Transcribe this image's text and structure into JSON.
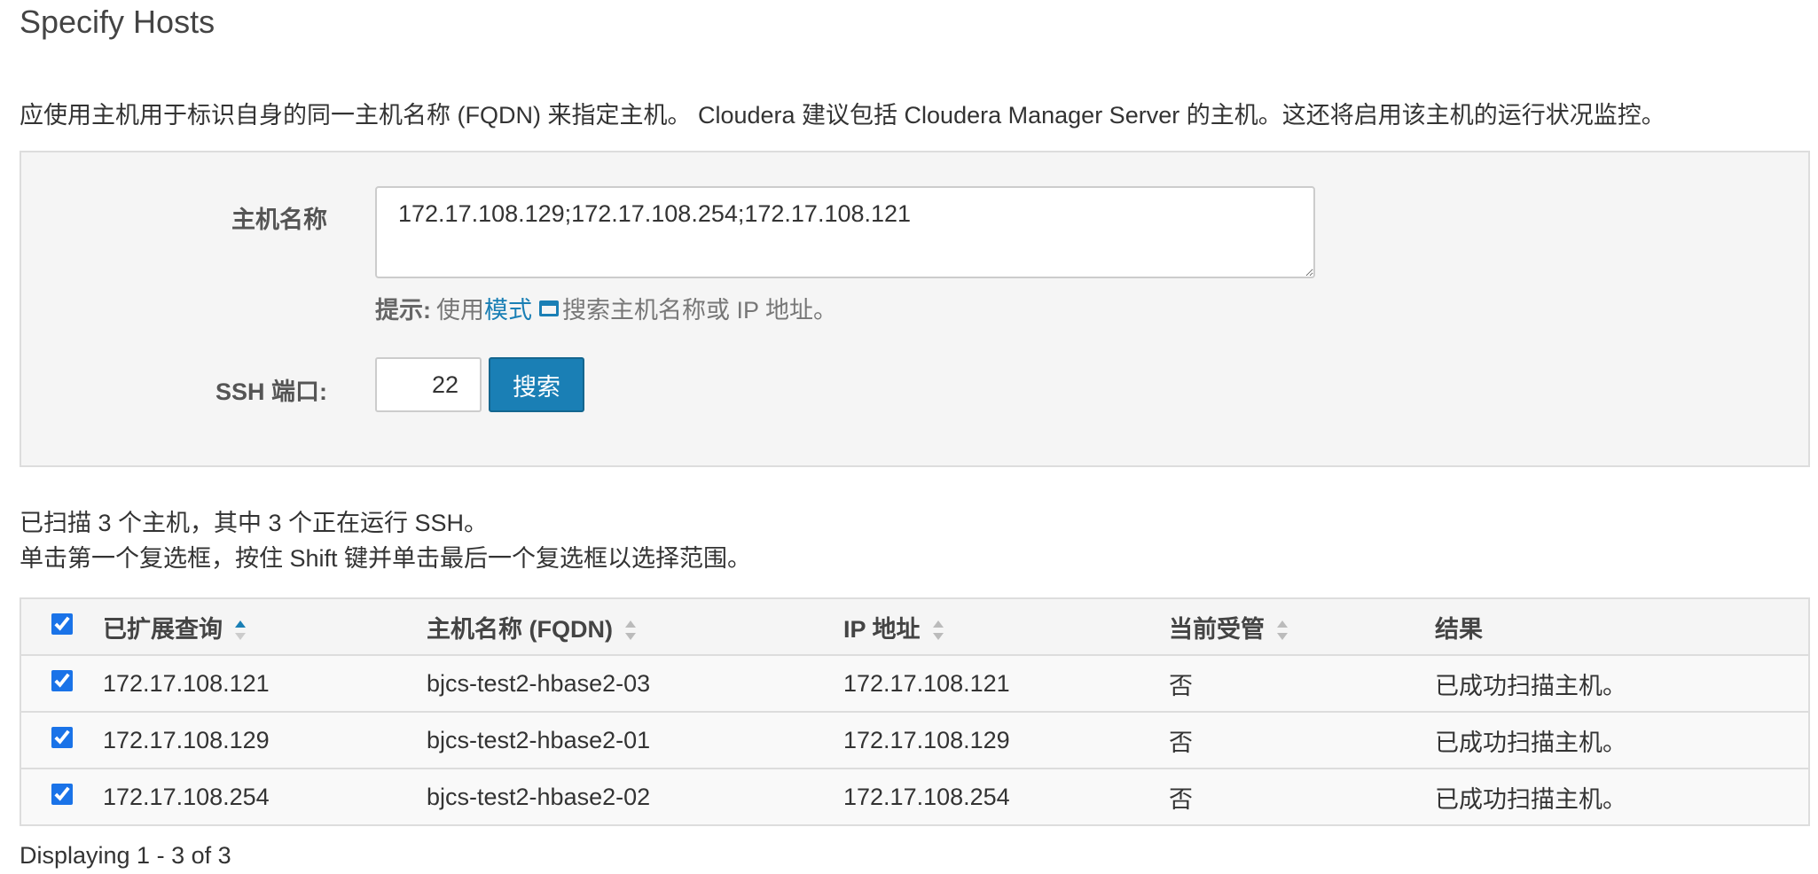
{
  "page": {
    "title": "Specify Hosts",
    "intro": "应使用主机用于标识自身的同一主机名称 (FQDN) 来指定主机。 Cloudera 建议包括 Cloudera Manager Server 的主机。这还将启用该主机的运行状况监控。"
  },
  "form": {
    "hostnames_label": "主机名称",
    "hostnames_value": "172.17.108.129;172.17.108.254;172.17.108.121",
    "hint_prefix": "提示:",
    "hint_text_before": "使用",
    "hint_link": "模式",
    "hint_icon": "window-icon",
    "hint_text_after": "搜索主机名称或 IP 地址。",
    "ssh_label": "SSH 端口:",
    "ssh_port": "22",
    "search_button": "搜索"
  },
  "scan": {
    "summary_line1": "已扫描 3 个主机，其中 3 个正在运行 SSH。",
    "summary_line2": "单击第一个复选框，按住 Shift 键并单击最后一个复选框以选择范围。"
  },
  "table": {
    "select_all_checked": true,
    "columns": [
      {
        "label": "已扩展查询",
        "sortable": true,
        "active": true
      },
      {
        "label": "主机名称 (FQDN)",
        "sortable": true,
        "active": false
      },
      {
        "label": "IP 地址",
        "sortable": true,
        "active": false
      },
      {
        "label": "当前受管",
        "sortable": true,
        "active": false
      },
      {
        "label": "结果",
        "sortable": false,
        "active": false
      }
    ],
    "rows": [
      {
        "checked": true,
        "expanded_query": "172.17.108.121",
        "fqdn": "bjcs-test2-hbase2-03",
        "ip": "172.17.108.121",
        "managed": "否",
        "result": "已成功扫描主机。"
      },
      {
        "checked": true,
        "expanded_query": "172.17.108.129",
        "fqdn": "bjcs-test2-hbase2-01",
        "ip": "172.17.108.129",
        "managed": "否",
        "result": "已成功扫描主机。"
      },
      {
        "checked": true,
        "expanded_query": "172.17.108.254",
        "fqdn": "bjcs-test2-hbase2-02",
        "ip": "172.17.108.254",
        "managed": "否",
        "result": "已成功扫描主机。"
      }
    ]
  },
  "footer": {
    "count_text": "Displaying 1 - 3 of 3"
  },
  "colors": {
    "accent": "#1a7fb5",
    "panel_bg": "#f5f5f5",
    "border": "#dddddd"
  }
}
